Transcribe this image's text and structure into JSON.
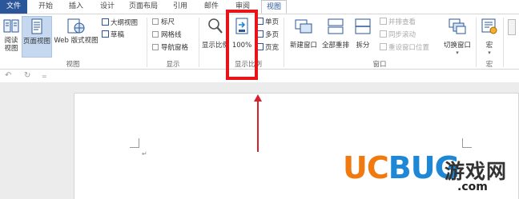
{
  "tabs": [
    {
      "label": "文件"
    },
    {
      "label": "开始"
    },
    {
      "label": "插入"
    },
    {
      "label": "设计"
    },
    {
      "label": "页面布局"
    },
    {
      "label": "引用"
    },
    {
      "label": "邮件"
    },
    {
      "label": "审阅"
    },
    {
      "label": "视图"
    }
  ],
  "ribbon": {
    "views": {
      "read_line1": "阅读",
      "read_line2": "视图",
      "page_view": "页面视图",
      "web_view": "Web 版式视图",
      "outline": "大纲视图",
      "draft": "草稿",
      "label": "视图"
    },
    "show": {
      "ruler": "标尺",
      "gridlines": "网格线",
      "nav_pane": "导航窗格",
      "label": "显示"
    },
    "zoom": {
      "zoom_btn": "显示比例",
      "hundred": "100%",
      "one_page": "单页",
      "multi_page": "多页",
      "page_width": "页宽",
      "label": "显示比例"
    },
    "window": {
      "new_window": "新建窗口",
      "arrange_all": "全部重排",
      "split": "拆分",
      "side_by_side": "并排查看",
      "sync_scroll": "同步滚动",
      "reset_position": "重设窗口位置",
      "switch_windows": "切换窗口",
      "label": "窗口"
    },
    "macros": {
      "macros_btn": "宏",
      "label": "宏"
    }
  },
  "quick_access": {
    "undo": "↶",
    "redo": "↻",
    "customize": "="
  },
  "document": {
    "paragraph_mark": "↵"
  },
  "watermark": {
    "brand_uc": "UC",
    "brand_bug": "BUG",
    "brand_cn": "游戏网",
    "domain": ".com"
  },
  "colors": {
    "file_tab": "#2b579a",
    "highlight": "#e8141a",
    "arrow": "#d9202a",
    "watermark_orange": "#f07a10",
    "watermark_blue": "#1e88d6"
  }
}
